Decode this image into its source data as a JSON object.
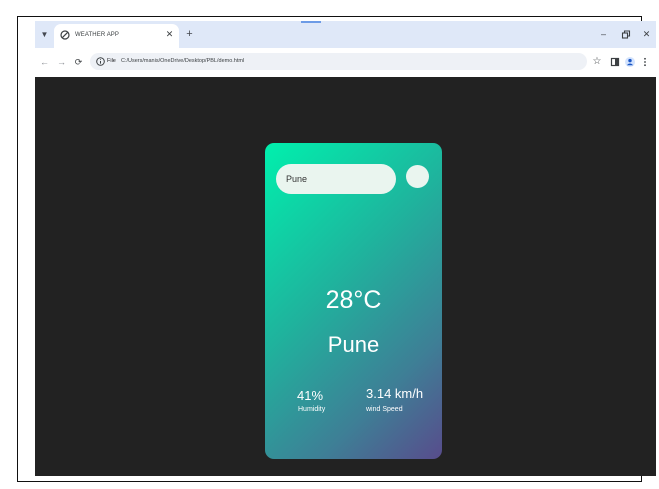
{
  "browser": {
    "tab": {
      "title": "WEATHER APP",
      "close_icon": "close-icon"
    },
    "new_tab_icon": "plus-icon",
    "tab_menu_icon": "chevron-down-icon",
    "window_controls": [
      "minimize-icon",
      "restore-icon",
      "close-icon"
    ],
    "address_bar": {
      "scheme": "File",
      "url": "C:/Users/manis/OneDrive/Desktop/PBL/demo.html"
    },
    "toolbar_icons": [
      "back-icon",
      "forward-icon",
      "reload-icon",
      "star-icon",
      "sidebar-icon",
      "profile-icon",
      "kebab-menu-icon"
    ]
  },
  "weather": {
    "search": {
      "value": "Pune"
    },
    "temperature": "28°C",
    "city": "Pune",
    "humidity": {
      "value": "41%",
      "label": "Humidity"
    },
    "wind": {
      "value": "3.14 km/h",
      "label": "wind Speed"
    }
  },
  "colors": {
    "page_background": "#222222",
    "card_gradient_start": "#00f0ad",
    "card_gradient_end": "#584c8c",
    "input_background": "#eaf5ef",
    "text": "#ffffff"
  }
}
